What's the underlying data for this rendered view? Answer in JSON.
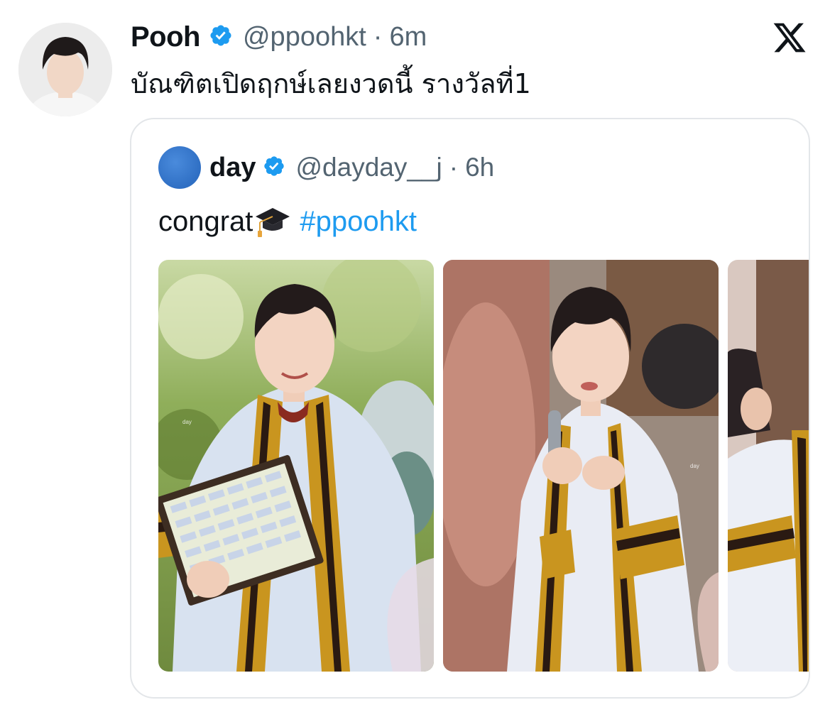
{
  "tweet": {
    "author": {
      "display_name": "Pooh",
      "handle": "@ppoohkt",
      "separator": "·",
      "time": "6m",
      "avatar_icon": "profile-photo"
    },
    "text": "บัณฑิตเปิดฤกษ์เลยงวดนี้ รางวัลที่1"
  },
  "platform_logo": "x-logo",
  "quoted_tweet": {
    "author": {
      "display_name": "day",
      "handle": "@dayday__j",
      "separator": "·",
      "time": "6h"
    },
    "text": "congrat",
    "emoji": "graduation-cap-icon",
    "hashtag": "#ppoohkt",
    "media": [
      {
        "name": "photo-1",
        "watermark": "day"
      },
      {
        "name": "photo-2",
        "watermark": "day"
      },
      {
        "name": "photo-3"
      }
    ]
  },
  "colors": {
    "verified": "#1d9bf0",
    "hashtag": "#1d9bf0",
    "secondary_text": "#536471",
    "primary_text": "#0f1419",
    "card_border": "#e3e6e9"
  }
}
